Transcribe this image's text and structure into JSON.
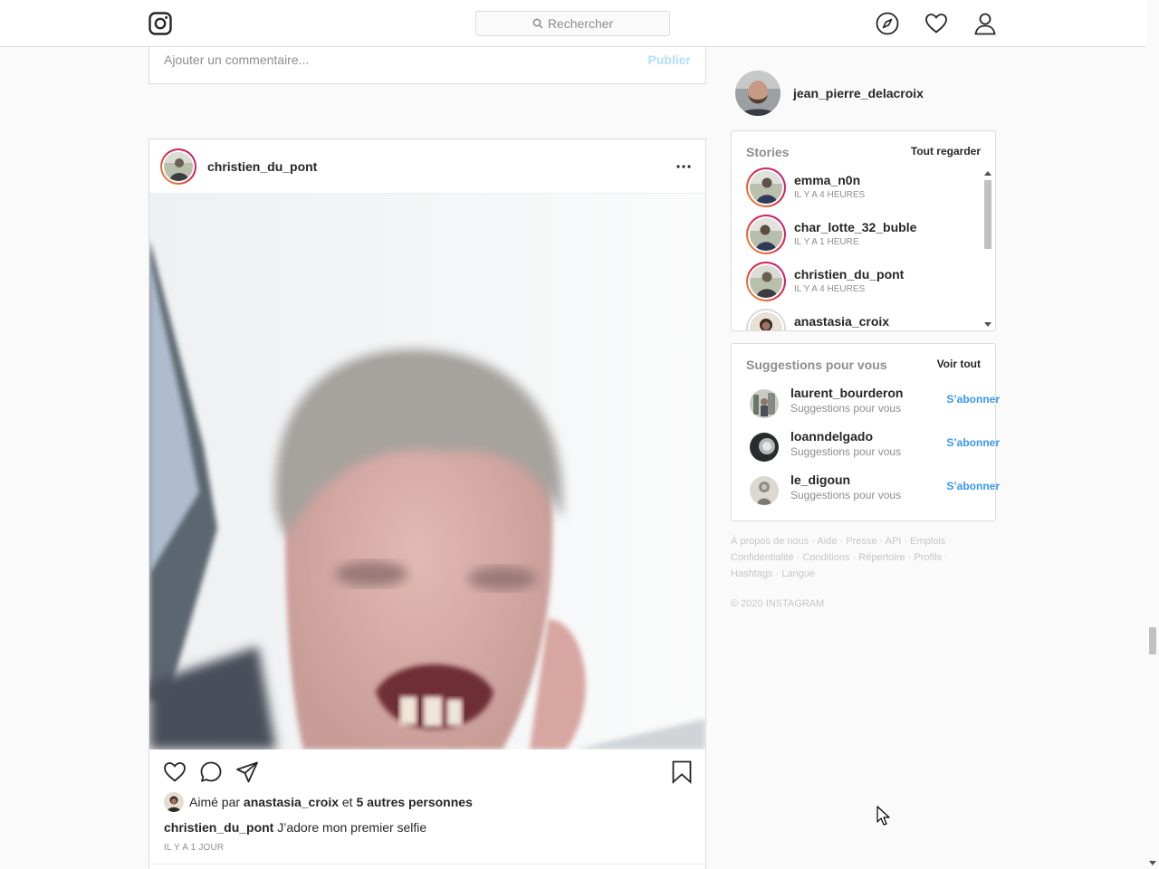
{
  "nav": {
    "search_placeholder": "Rechercher",
    "icons": [
      "instagram-logo-icon",
      "search-icon",
      "compass-icon",
      "heart-icon",
      "profile-icon"
    ]
  },
  "previous_post": {
    "comment_placeholder": "Ajouter un commentaire...",
    "publish_label": "Publier"
  },
  "post": {
    "username": "christien_du_pont",
    "liked_prefix": "Aimé par",
    "liked_user": "anastasia_croix",
    "liked_and": "et",
    "liked_others": "5 autres personnes",
    "caption_user": "christien_du_pont",
    "caption_text": "J’adore mon premier selfie",
    "date": "IL Y A 1 JOUR"
  },
  "sidebar": {
    "current_user": "jean_pierre_delacroix",
    "stories": {
      "title": "Stories",
      "see_all": "Tout regarder",
      "items": [
        {
          "name": "emma_n0n",
          "time": "IL Y A 4 HEURES"
        },
        {
          "name": "char_lotte_32_buble",
          "time": "IL Y A 1 HEURE"
        },
        {
          "name": "christien_du_pont",
          "time": "IL Y A 4 HEURES"
        },
        {
          "name": "anastasia_croix",
          "time": ""
        }
      ]
    },
    "suggestions": {
      "title": "Suggestions pour vous",
      "see_all": "Voir tout",
      "items": [
        {
          "name": "laurent_bourderon",
          "sub": "Suggestions pour vous",
          "follow": "S’abonner"
        },
        {
          "name": "loanndelgado",
          "sub": "Suggestions pour vous",
          "follow": "S’abonner"
        },
        {
          "name": "le_digoun",
          "sub": "Suggestions pour vous",
          "follow": "S’abonner"
        }
      ]
    },
    "footer_links": [
      "À propos de nous",
      "Aide",
      "Presse",
      "API",
      "Emplois",
      "Confidentialité",
      "Conditions",
      "Répertoire",
      "Profils",
      "Hashtags",
      "Langue"
    ],
    "copyright": "© 2020 INSTAGRAM"
  },
  "colors": {
    "link_blue": "#3897f0",
    "publish_disabled": "#b2dffc",
    "muted": "#8e8e8e",
    "border": "#dbdbdb"
  }
}
